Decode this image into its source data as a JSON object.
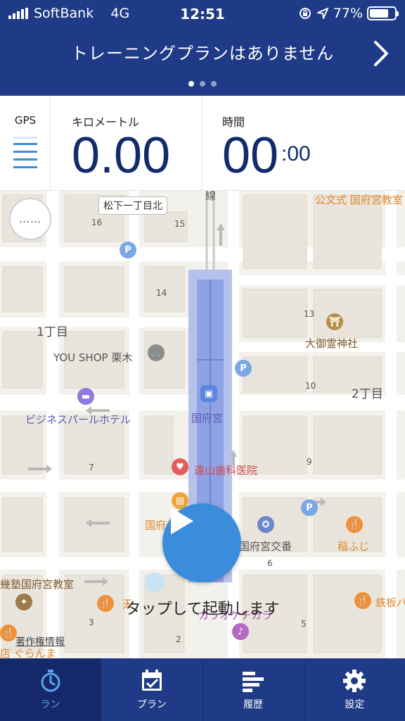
{
  "status_bar": {
    "carrier": "SoftBank",
    "network": "4G",
    "time": "12:51",
    "battery": "77%",
    "battery_fraction": 0.77
  },
  "banner": {
    "title": "トレーニングプランはありません",
    "page_count": 3,
    "active_page": 1
  },
  "stats": {
    "gps_label": "GPS",
    "distance_label": "キロメートル",
    "distance_value": "0.00",
    "time_label": "時間",
    "time_minutes": "00",
    "time_seconds": ":00"
  },
  "map": {
    "more_button": "……",
    "labels": {
      "sign": "松下一丁目北",
      "n16a": "16",
      "n15": "15",
      "n14": "14",
      "n13": "13",
      "n10": "10",
      "n9": "9",
      "n7": "7",
      "n6": "6",
      "n3": "3",
      "n2": "2",
      "n5": "5",
      "chome1": "1丁目",
      "chome2": "2丁目",
      "line": "線",
      "school": "公文式 国府宮教室",
      "shrine": "大御霊神社",
      "shop": "YOU SHOP 栗木",
      "hotel": "ビジネスパールホテル",
      "station": "国府宮",
      "dental": "遠山歯科医院",
      "police": "国府宮交番",
      "inafuji": "稲ふじ",
      "juku": "幾塾国府宮教室",
      "tetsuban": "鉄板バ",
      "kokufu_partial": "国府",
      "karaoke": "カラオケチカラ",
      "ten": "天",
      "guran": "店 ぐらんま"
    },
    "tap_text": "タップして起動します",
    "copyright": "著作権情報"
  },
  "tabs": [
    {
      "label": "ラン",
      "icon": "stopwatch-icon",
      "active": true
    },
    {
      "label": "プラン",
      "icon": "calendar-icon",
      "active": false
    },
    {
      "label": "履歴",
      "icon": "history-icon",
      "active": false
    },
    {
      "label": "設定",
      "icon": "gear-icon",
      "active": false
    }
  ],
  "colors": {
    "header_bg": "#1f3a86",
    "accent": "#3b8ddb",
    "value_text": "#122b6b",
    "active_tab": "#5aa5ef"
  }
}
